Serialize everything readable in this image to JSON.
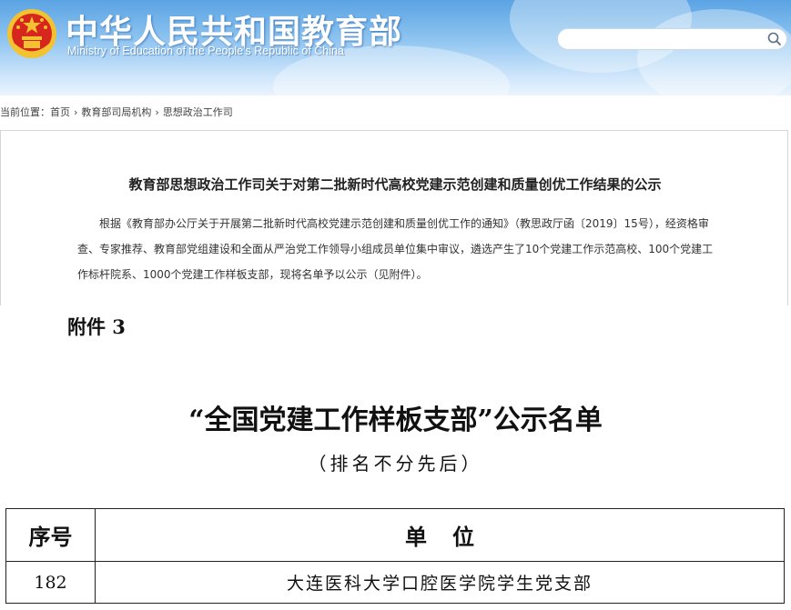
{
  "header": {
    "title": "中华人民共和国教育部",
    "subtitle": "Ministry of Education of the People's Republic of China",
    "search_placeholder": ""
  },
  "breadcrumb": {
    "prefix": "当前位置：",
    "items": [
      "首页",
      "教育部司局机构",
      "思想政治工作司"
    ]
  },
  "article": {
    "title": "教育部思想政治工作司关于对第二批新时代高校党建示范创建和质量创优工作结果的公示",
    "body": "根据《教育部办公厅关于开展第二批新时代高校党建示范创建和质量创优工作的通知》（教思政厅函〔2019〕15号），经资格审查、专家推荐、教育部党组建设和全面从严治党工作领导小组成员单位集中审议，遴选产生了10个党建工作示范高校、100个党建工作标杆院系、1000个党建工作样板支部，现将名单予以公示（见附件）。"
  },
  "attachment": {
    "label": "附件 3",
    "title": "“全国党建工作样板支部”公示名单",
    "subtitle": "（排名不分先后）",
    "table": {
      "headers": [
        "序号",
        "单位"
      ],
      "rows": [
        [
          "182",
          "大连医科大学口腔医学院学生党支部"
        ]
      ]
    }
  },
  "colors": {
    "header_top": "#5aa3e3",
    "header_bottom": "#e9f4fd",
    "emblem_red": "#d7261e",
    "emblem_gold": "#f2c230"
  }
}
